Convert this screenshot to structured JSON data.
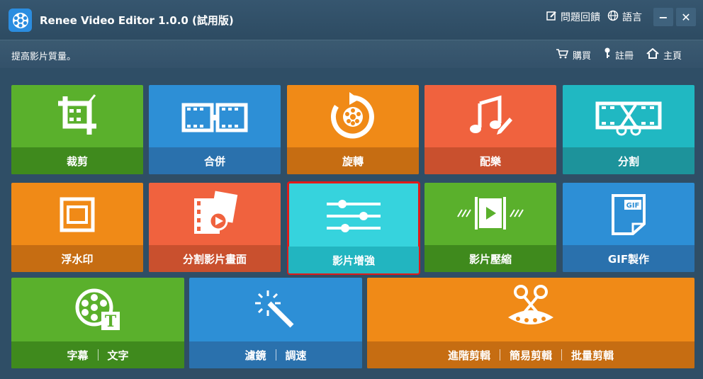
{
  "titlebar": {
    "title": "Renee Video Editor 1.0.0 (試用版)",
    "feedback_label": "問題回饋",
    "language_label": "語言",
    "minimize_label": "−",
    "close_label": "✕"
  },
  "subbar": {
    "hint": "提高影片質量。",
    "buy_label": "購買",
    "register_label": "註冊",
    "home_label": "主頁"
  },
  "tiles": {
    "crop": "裁剪",
    "merge": "合併",
    "rotate": "旋轉",
    "music": "配樂",
    "split": "分割",
    "watermark": "浮水印",
    "split_screen": "分割影片畫面",
    "enhance": "影片增強",
    "compress": "影片壓縮",
    "gif": "GIF製作",
    "subtitle": "字幕",
    "text": "文字",
    "filter": "濾鏡",
    "speed": "調速",
    "advanced_edit": "進階剪輯",
    "simple_edit": "簡易剪輯",
    "batch_edit": "批量剪輯"
  },
  "icons": {
    "gif_text": "GIF"
  },
  "colors": {
    "background": "#2f4e66",
    "selected_outline": "#e01a1a"
  }
}
